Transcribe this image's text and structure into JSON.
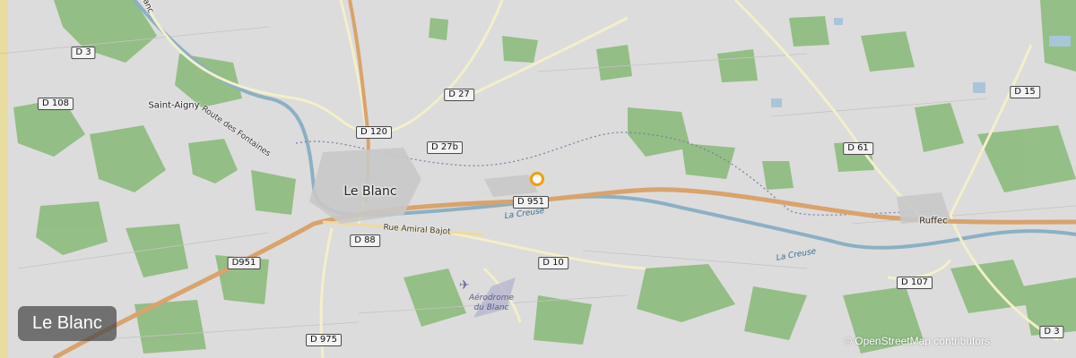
{
  "map": {
    "title": "Le Blanc",
    "attribution": "© OpenStreetMap contributors",
    "colors": {
      "marker": "#f29e0c",
      "river": "#8bb0c4",
      "woodland": "#7fb26f",
      "trunk_road": "#d9a36b",
      "background": "#dcdcdc"
    },
    "places": {
      "le_blanc": "Le Blanc",
      "saint_aigny": "Saint-Aigny",
      "ruffec": "Ruffec",
      "top_fragment": "Blanc"
    },
    "roads": {
      "d3": "D 3",
      "d108": "D 108",
      "d27": "D 27",
      "d120": "D 120",
      "d27b": "D 27b",
      "d951_east": "D 951",
      "d951_west": "D951",
      "d88": "D 88",
      "d10": "D 10",
      "d975": "D 975",
      "d61": "D 61",
      "d15": "D 15",
      "d107": "D 107",
      "d3_south": "D 3"
    },
    "street_names": {
      "route_des_fontaines": "Route des Fontaines",
      "rue_amiral_bajot": "Rue Amiral Bajot"
    },
    "rivers": {
      "creuse_west": "La Creuse",
      "creuse_east": "La Creuse"
    },
    "aerodrome": {
      "line1": "Aérodrome",
      "line2": "du Blanc"
    },
    "icons": {
      "marker": "location-marker-icon",
      "airport": "airport-icon"
    }
  }
}
